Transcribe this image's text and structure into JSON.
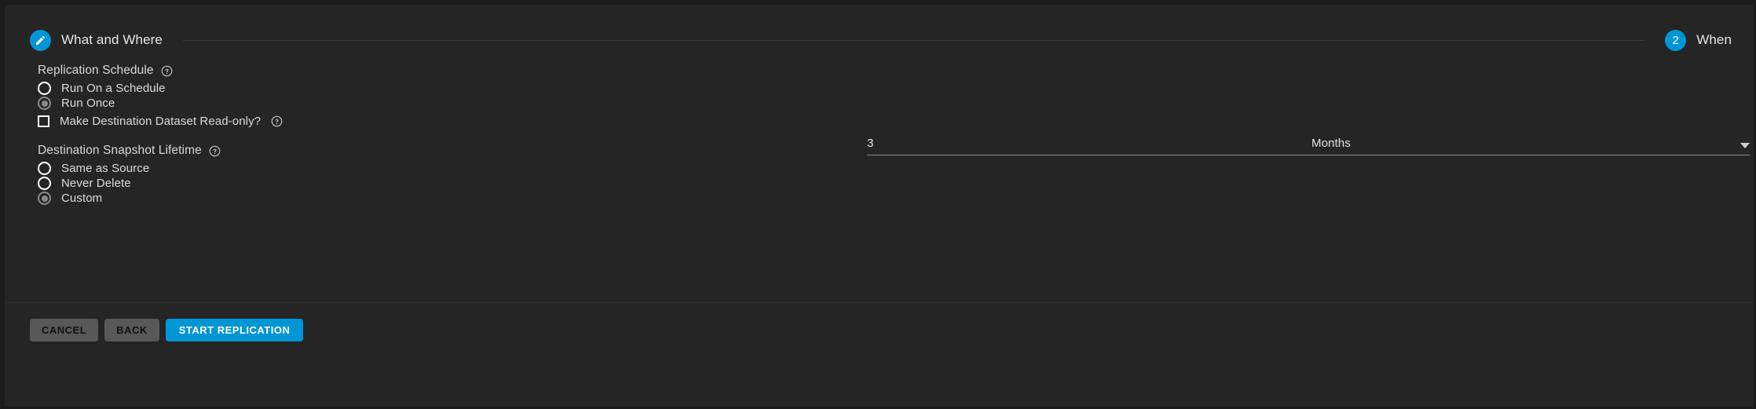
{
  "theme": {
    "background": "#252525",
    "page_background": "#1c1c1c",
    "accent": "#0095d5",
    "text": "#dcdcdc",
    "divider": "#303030",
    "field_underline": "#8c8c8c",
    "radio_selected": "#8a8a8a"
  },
  "stepper": {
    "steps": [
      {
        "id": "what-and-where",
        "label": "What and Where",
        "state": "completed",
        "icon": "pencil-icon",
        "number": ""
      },
      {
        "id": "when",
        "label": "When",
        "state": "active",
        "icon": "",
        "number": "2"
      }
    ]
  },
  "form": {
    "replication_schedule": {
      "label": "Replication Schedule",
      "help_icon": "help-circle-icon",
      "options": [
        {
          "label": "Run On a Schedule",
          "selected": false
        },
        {
          "label": "Run Once",
          "selected": true
        }
      ]
    },
    "read_only_checkbox": {
      "label": "Make Destination Dataset Read-only?",
      "help_icon": "help-circle-icon",
      "checked": false
    },
    "snapshot_lifetime": {
      "label": "Destination Snapshot Lifetime",
      "help_icon": "help-circle-icon",
      "options": [
        {
          "label": "Same as Source",
          "selected": false
        },
        {
          "label": "Never Delete",
          "selected": false
        },
        {
          "label": "Custom",
          "selected": true
        }
      ]
    },
    "lifetime_value": {
      "label": "",
      "value": "3",
      "placeholder": ""
    },
    "lifetime_unit": {
      "value": "Months",
      "caret_icon": "chevron-down-icon"
    }
  },
  "actions": {
    "cancel_label": "CANCEL",
    "back_label": "BACK",
    "submit_label": "START REPLICATION"
  }
}
